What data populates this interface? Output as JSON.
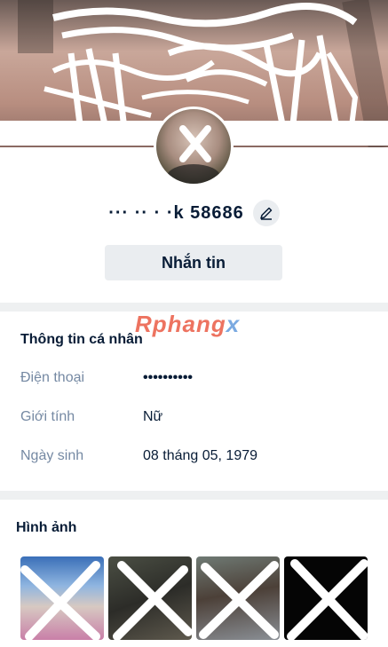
{
  "profile": {
    "name": "··· ·· ·  ·k 58686",
    "message_button": "Nhắn tin"
  },
  "watermark": {
    "part1": "Rphang",
    "part2": "x"
  },
  "personal_info": {
    "title": "Thông tin cá nhân",
    "rows": [
      {
        "label": "Điện thoại",
        "value": "••••••••••"
      },
      {
        "label": "Giới tính",
        "value": "Nữ"
      },
      {
        "label": "Ngày sinh",
        "value": "08 tháng 05, 1979"
      }
    ]
  },
  "photos": {
    "title": "Hình ảnh",
    "items": [
      "photo-1",
      "photo-2",
      "photo-3",
      "photo-4"
    ]
  },
  "icons": {
    "edit": "pencil-icon"
  },
  "colors": {
    "text_primary": "#081c36",
    "text_secondary": "#7589a3",
    "button_bg": "#eaedf0",
    "divider": "#eef0f1"
  }
}
